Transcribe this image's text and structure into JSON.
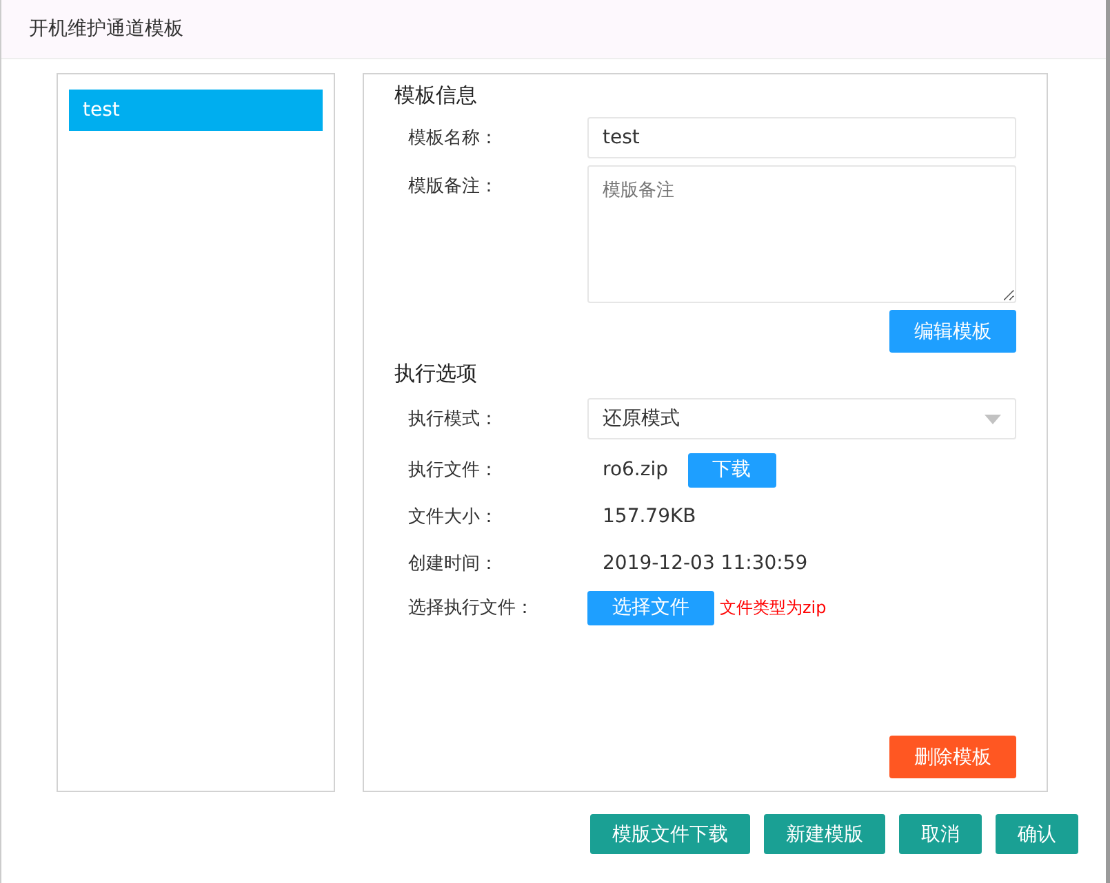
{
  "window": {
    "title": "开机维护通道模板"
  },
  "templates": [
    {
      "label": "test",
      "selected": true
    }
  ],
  "info": {
    "heading": "模板信息",
    "name": {
      "label": "模板名称：",
      "value": "test"
    },
    "note": {
      "label": "模版备注：",
      "placeholder": "模版备注"
    },
    "edit_button": "编辑模板"
  },
  "exec": {
    "heading": "执行选项",
    "mode": {
      "label": "执行模式：",
      "value": "还原模式"
    },
    "file": {
      "label": "执行文件：",
      "value": "ro6.zip",
      "button": "下载"
    },
    "size": {
      "label": "文件大小：",
      "value": "157.79KB"
    },
    "created": {
      "label": "创建时间：",
      "value": "2019-12-03 11:30:59"
    },
    "choose": {
      "label": "选择执行文件：",
      "button": "选择文件",
      "hint": "文件类型为zip"
    },
    "delete_button": "删除模板"
  },
  "footer_buttons": [
    "模版文件下载",
    "新建模版",
    "取消",
    "确认"
  ]
}
